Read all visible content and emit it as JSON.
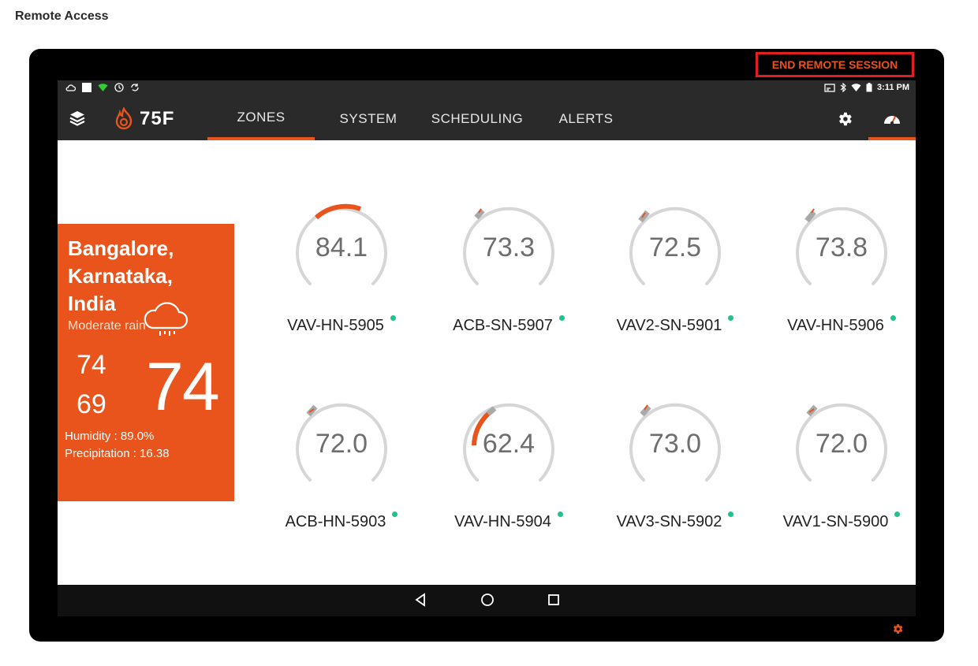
{
  "page": {
    "title": "Remote Access"
  },
  "session": {
    "end_label": "END REMOTE SESSION"
  },
  "statusbar": {
    "left_icons": [
      "cloud-icon",
      "square-icon",
      "wifi-icon",
      "clock-icon",
      "sync-icon"
    ],
    "right_icons": [
      "cast-icon",
      "bluetooth-icon",
      "wifi-icon",
      "battery-icon"
    ],
    "time": "3:11 PM"
  },
  "nav": {
    "logo_text": "75F",
    "tabs": [
      {
        "label": "ZONES",
        "active": true
      },
      {
        "label": "SYSTEM",
        "active": false
      },
      {
        "label": "SCHEDULING",
        "active": false
      },
      {
        "label": "ALERTS",
        "active": false
      }
    ],
    "right_icons": [
      "settings-icon",
      "dashboard-gauge-icon"
    ]
  },
  "weather": {
    "location": "Bangalore, Karnataka, India",
    "condition": "Moderate rain",
    "high": "74",
    "low": "69",
    "current_temp": "74",
    "humidity": "Humidity : 89.0%",
    "precipitation": "Precipitation : 16.38",
    "icon": "rain-cloud-icon"
  },
  "zones": [
    {
      "name": "VAV-HN-5905",
      "value": "84.1",
      "status": "online"
    },
    {
      "name": "ACB-SN-5907",
      "value": "73.3",
      "status": "online"
    },
    {
      "name": "VAV2-SN-5901",
      "value": "72.5",
      "status": "online"
    },
    {
      "name": "VAV-HN-5906",
      "value": "73.8",
      "status": "online"
    },
    {
      "name": "ACB-HN-5903",
      "value": "72.0",
      "status": "online"
    },
    {
      "name": "VAV-HN-5904",
      "value": "62.4",
      "status": "online"
    },
    {
      "name": "VAV3-SN-5902",
      "value": "73.0",
      "status": "online"
    },
    {
      "name": "VAV1-SN-5900",
      "value": "72.0",
      "status": "online"
    }
  ],
  "colors": {
    "accent": "#e8541b",
    "online": "#1fc28b",
    "bar": "#2a2a2a"
  },
  "android_nav": [
    "back-icon",
    "home-icon",
    "recents-icon"
  ]
}
